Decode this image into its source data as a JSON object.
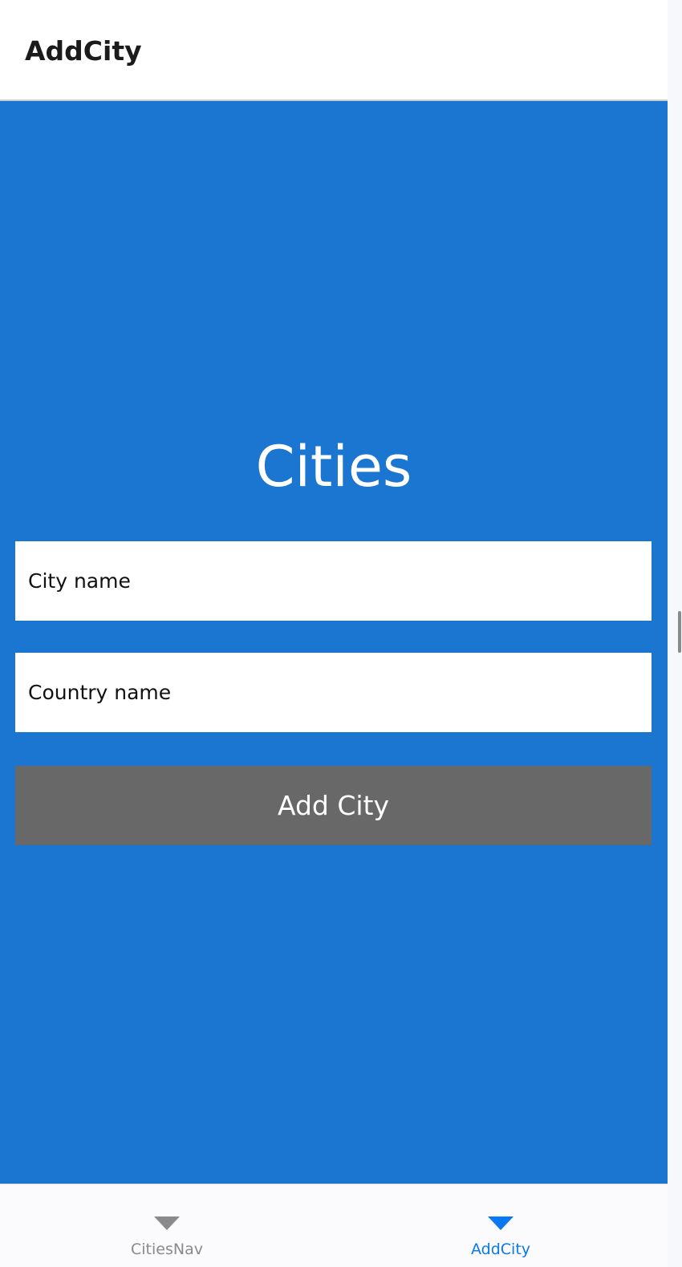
{
  "header": {
    "title": "AddCity"
  },
  "main": {
    "heading": "Cities",
    "city_input": {
      "placeholder": "City name",
      "value": ""
    },
    "country_input": {
      "placeholder": "Country name",
      "value": ""
    },
    "add_button_label": "Add City"
  },
  "tabs": [
    {
      "label": "CitiesNav",
      "icon": "chevron-down-icon",
      "selected": false
    },
    {
      "label": "AddCity",
      "icon": "chevron-down-icon",
      "selected": true
    }
  ],
  "colors": {
    "content_background": "#1b76d2",
    "button_background": "#686868",
    "selected_tab": "#0a78f0",
    "unselected_tab": "#8a8a8a"
  }
}
